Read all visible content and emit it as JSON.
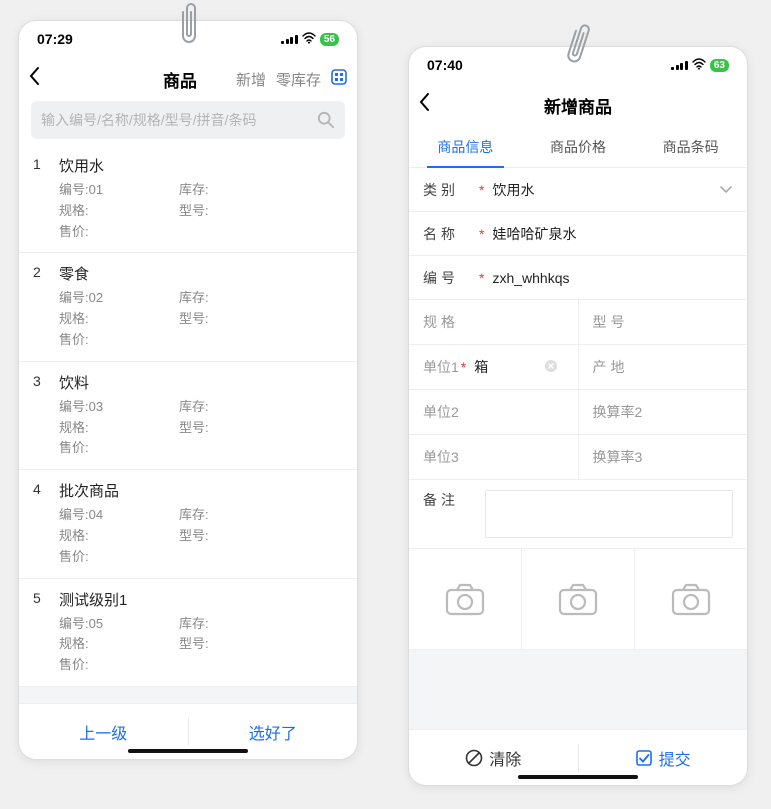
{
  "left": {
    "status": {
      "time": "07:29",
      "battery": "56"
    },
    "nav": {
      "title": "商品",
      "action_add": "新增",
      "action_zero": "零库存"
    },
    "search": {
      "placeholder": "输入编号/名称/规格/型号/拼音/条码"
    },
    "label": {
      "code_prefix": "编号:",
      "stock": "库存:",
      "spec": "规格:",
      "model": "型号:",
      "price": "售价:"
    },
    "items": [
      {
        "idx": "1",
        "name": "饮用水",
        "code": "01"
      },
      {
        "idx": "2",
        "name": "零食",
        "code": "02"
      },
      {
        "idx": "3",
        "name": "饮料",
        "code": "03"
      },
      {
        "idx": "4",
        "name": "批次商品",
        "code": "04"
      },
      {
        "idx": "5",
        "name": "测试级别1",
        "code": "05"
      }
    ],
    "footer": {
      "up": "上一级",
      "done": "选好了"
    }
  },
  "right": {
    "status": {
      "time": "07:40",
      "battery": "63"
    },
    "nav": {
      "title": "新增商品"
    },
    "tabs": {
      "t1": "商品信息",
      "t2": "商品价格",
      "t3": "商品条码"
    },
    "form": {
      "category_label": "类别",
      "category_value": "饮用水",
      "name_label": "名称",
      "name_value": "娃哈哈矿泉水",
      "code_label": "编号",
      "code_value": "zxh_whhkqs",
      "spec_label": "规格",
      "model_label": "型号",
      "unit1_label": "单位1",
      "unit1_value": "箱",
      "origin_label": "产地",
      "unit2_label": "单位2",
      "rate2_label": "换算率2",
      "unit3_label": "单位3",
      "rate3_label": "换算率3",
      "remark_label": "备注"
    },
    "footer": {
      "clear": "清除",
      "submit": "提交"
    }
  }
}
